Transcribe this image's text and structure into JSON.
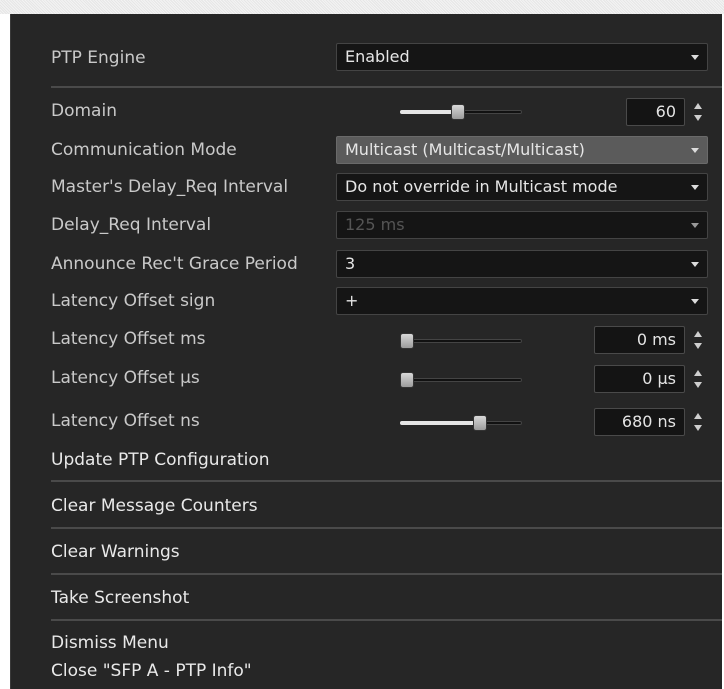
{
  "menu": {
    "ptp_engine": {
      "label": "PTP Engine",
      "value": "Enabled"
    },
    "domain": {
      "label": "Domain",
      "value": "60",
      "slider_fraction": 0.47
    },
    "communication_mode": {
      "label": "Communication Mode",
      "value": "Multicast (Multicast/Multicast)"
    },
    "masters_delay_req_interval": {
      "label": "Master's Delay_Req Interval",
      "value": "Do not override in Multicast mode"
    },
    "delay_req_interval": {
      "label": "Delay_Req Interval",
      "value": "125 ms"
    },
    "announce_grace_period": {
      "label": "Announce Rec't Grace Period",
      "value": "3"
    },
    "latency_offset_sign": {
      "label": "Latency Offset sign",
      "value": "+"
    },
    "latency_offset_ms": {
      "label": "Latency Offset ms",
      "value": "0 ms",
      "slider_fraction": 0.0
    },
    "latency_offset_us": {
      "label": "Latency Offset μs",
      "value": "0 μs",
      "slider_fraction": 0.0
    },
    "latency_offset_ns": {
      "label": "Latency Offset ns",
      "value": "680 ns",
      "slider_fraction": 0.68
    },
    "update_ptp": "Update PTP Configuration",
    "clear_counters": "Clear Message Counters",
    "clear_warnings": "Clear Warnings",
    "take_screenshot": "Take Screenshot",
    "dismiss_menu": "Dismiss Menu",
    "close_window": "Close \"SFP A - PTP Info\""
  },
  "colors": {
    "panel": "#262626",
    "field": "#151515",
    "selected": "#5b5b5b",
    "text": "#c9c9c9"
  },
  "icons": [
    "dropdown-arrow-icon",
    "spinner-up-icon",
    "spinner-down-icon",
    "slider-thumb"
  ]
}
